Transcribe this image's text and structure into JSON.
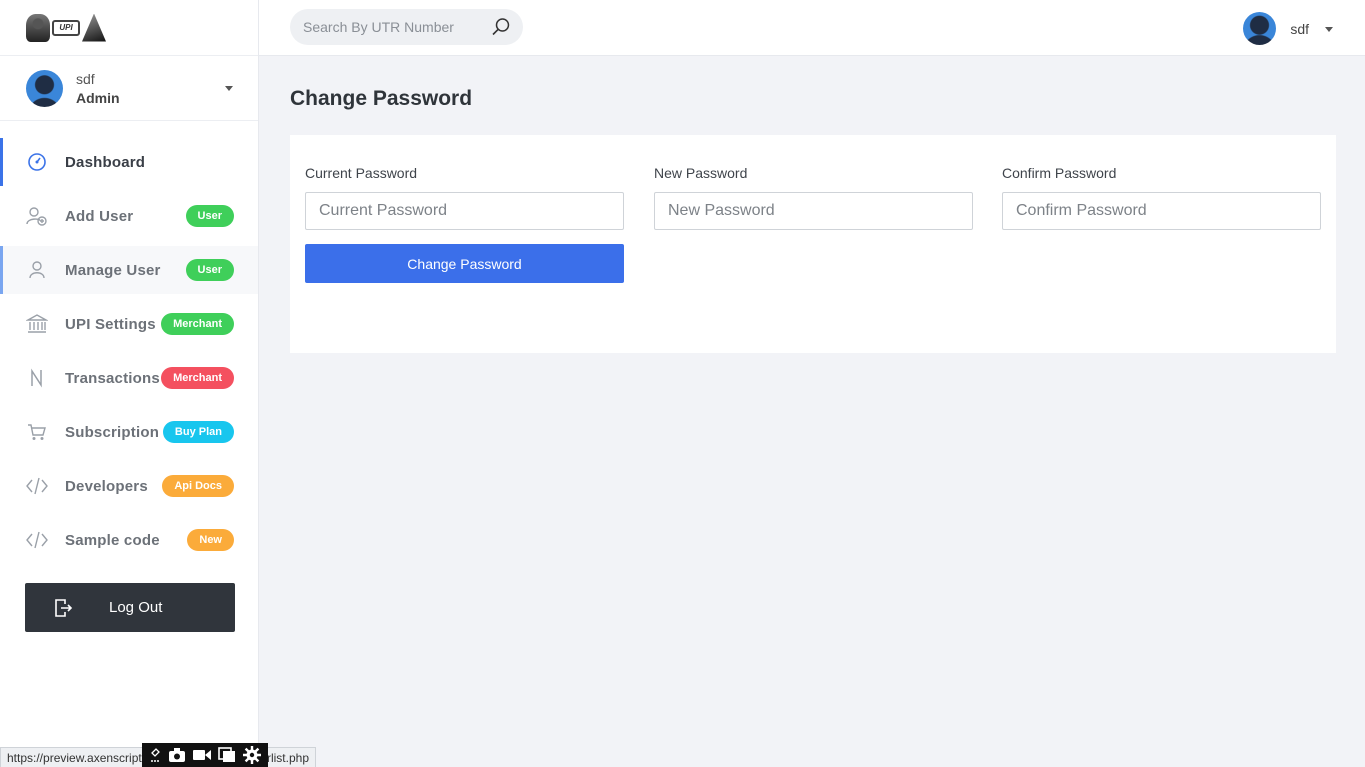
{
  "sidebar": {
    "user": {
      "name": "sdf",
      "role": "Admin"
    },
    "items": [
      {
        "label": "Dashboard",
        "badge": ""
      },
      {
        "label": "Add User",
        "badge": "User"
      },
      {
        "label": "Manage User",
        "badge": "User"
      },
      {
        "label": "UPI Settings",
        "badge": "Merchant"
      },
      {
        "label": "Transactions",
        "badge": "Merchant"
      },
      {
        "label": "Subscription",
        "badge": "Buy Plan"
      },
      {
        "label": "Developers",
        "badge": "Api Docs"
      },
      {
        "label": "Sample code",
        "badge": "New"
      }
    ],
    "logout_label": "Log Out"
  },
  "logo": {
    "upi_text": "UPI"
  },
  "topbar": {
    "search_placeholder": "Search By UTR Number",
    "user_name": "sdf"
  },
  "main": {
    "title": "Change Password",
    "fields": [
      {
        "label": "Current Password",
        "placeholder": "Current Password"
      },
      {
        "label": "New Password",
        "placeholder": "New Password"
      },
      {
        "label": "Confirm Password",
        "placeholder": "Confirm Password"
      }
    ],
    "submit_label": "Change Password"
  },
  "status": {
    "url_start": "https://preview.axenscript",
    "url_end": "rlist.php"
  },
  "colors": {
    "accent": "#3b6fea",
    "badge_green": "#3fcf5a",
    "badge_red": "#f4505f",
    "badge_cyan": "#18c6ee",
    "badge_orange": "#fbab3a",
    "logout_bg": "#30353c"
  }
}
